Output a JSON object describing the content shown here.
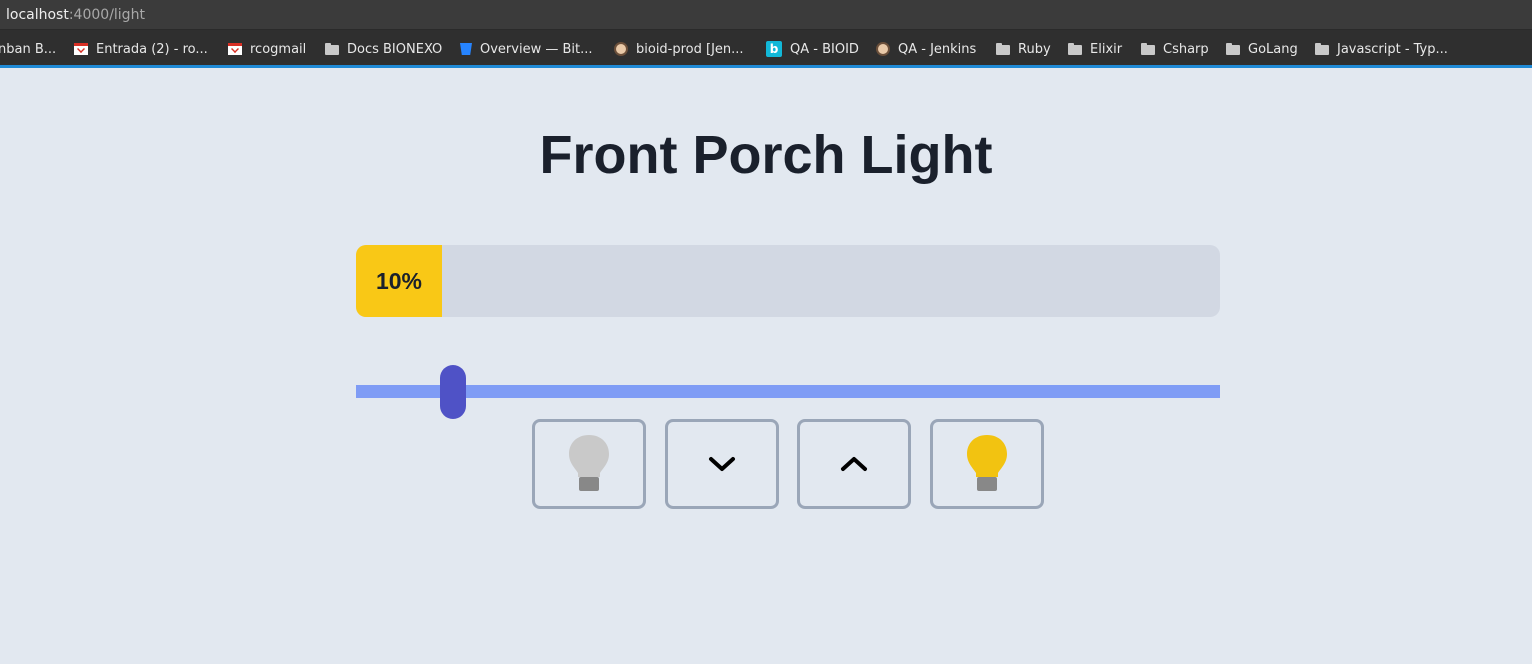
{
  "browser": {
    "url_host": "localhost",
    "url_path": ":4000/light",
    "bookmarks": [
      {
        "label": "nban B...",
        "icon": "none"
      },
      {
        "label": "Entrada (2) - ro...",
        "icon": "gmail-icon"
      },
      {
        "label": "rcogmail",
        "icon": "gmail-icon"
      },
      {
        "label": "Docs BIONEXO",
        "icon": "folder-icon"
      },
      {
        "label": "Overview — Bit...",
        "icon": "bitbucket-icon"
      },
      {
        "label": "bioid-prod [Jen...",
        "icon": "jenkins-icon"
      },
      {
        "label": "QA - BIOID",
        "icon": "b-icon"
      },
      {
        "label": "QA - Jenkins",
        "icon": "jenkins-icon"
      },
      {
        "label": "Ruby",
        "icon": "folder-icon"
      },
      {
        "label": "Elixir",
        "icon": "folder-icon"
      },
      {
        "label": "Csharp",
        "icon": "folder-icon"
      },
      {
        "label": "GoLang",
        "icon": "folder-icon"
      },
      {
        "label": "Javascript - Typ...",
        "icon": "folder-icon"
      }
    ]
  },
  "page": {
    "title": "Front Porch Light",
    "brightness_label": "10%",
    "brightness_percent": 10,
    "colors": {
      "background": "#e2e8f0",
      "meter_fill": "#f9c816",
      "meter_track": "#d2d8e3",
      "slider_track": "#7f9cf5",
      "slider_thumb": "#4f52c6",
      "bulb_on": "#f2c311",
      "bulb_off": "#c9c9c9"
    },
    "buttons": [
      {
        "name": "off-button",
        "icon": "lightbulb-off-icon"
      },
      {
        "name": "down-button",
        "icon": "chevron-down-icon"
      },
      {
        "name": "up-button",
        "icon": "chevron-up-icon"
      },
      {
        "name": "on-button",
        "icon": "lightbulb-on-icon"
      }
    ]
  }
}
